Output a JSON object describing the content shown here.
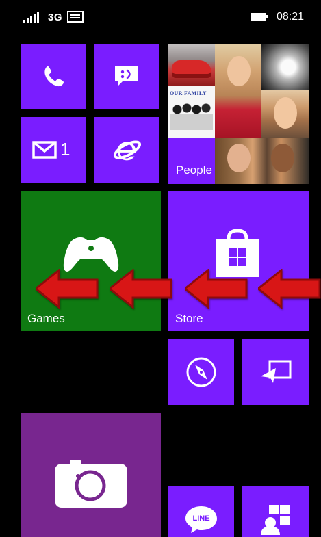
{
  "status_bar": {
    "network": "3G",
    "time": "08:21"
  },
  "icons": {
    "signal": "signal-icon",
    "message": "message-icon",
    "battery": "battery-icon",
    "phone": "phone-icon",
    "messaging": "messaging-icon",
    "mail": "mail-icon",
    "internet_explorer": "internet-explorer-icon",
    "games": "games-icon",
    "store": "store-icon",
    "compass": "compass-icon",
    "project_my_screen": "project-screen-icon",
    "camera": "camera-icon",
    "line": "line-icon",
    "people_hub": "people-hub-icon",
    "arrow": "left-arrow-icon"
  },
  "tiles": {
    "phone": {},
    "messaging": {},
    "mail": {
      "badge": "1"
    },
    "internet_explorer": {},
    "people": {
      "label": "People",
      "collage_text": "OUR FAMILY"
    },
    "games": {
      "label": "Games"
    },
    "store": {
      "label": "Store"
    },
    "line": {
      "text": "LINE"
    }
  },
  "colors": {
    "background": "#000000",
    "tile_purple": "#7a1dff",
    "tile_green": "#0f7a12",
    "tile_magenta": "#78268f",
    "arrow_red": "#d81616"
  }
}
